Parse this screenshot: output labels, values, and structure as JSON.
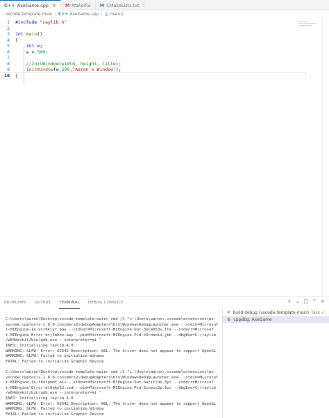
{
  "tabs": [
    {
      "icon": "C++",
      "label": "AxeGame.cpp",
      "active": true,
      "close": "×"
    },
    {
      "icon": "M",
      "label": "Makefile",
      "active": false,
      "italic": true
    },
    {
      "icon": "M",
      "label": "CMakeLists.txt",
      "active": false
    }
  ],
  "breadcrumb": {
    "folder": "vscode-template-main",
    "sep": "›",
    "file_icon": "C++",
    "file": "AxeGame.cpp",
    "symbol": "main()"
  },
  "code_lines": [
    {
      "n": "1",
      "tokens": [
        {
          "t": "#include ",
          "c": "tk-pre"
        },
        {
          "t": "\"raylib.h\"",
          "c": "tk-str"
        }
      ]
    },
    {
      "n": "2",
      "tokens": []
    },
    {
      "n": "3",
      "tokens": [
        {
          "t": "int",
          "c": "tk-kw"
        },
        {
          "t": " ",
          "c": ""
        },
        {
          "t": "main",
          "c": "tk-fn"
        },
        {
          "t": "()",
          "c": ""
        }
      ]
    },
    {
      "n": "4",
      "tokens": [
        {
          "t": "{",
          "c": ""
        }
      ]
    },
    {
      "n": "5",
      "tokens": [
        {
          "t": "    ",
          "c": ""
        },
        {
          "t": "int",
          "c": "tk-kw"
        },
        {
          "t": " ",
          "c": ""
        },
        {
          "t": "w",
          "c": "tk-var"
        },
        {
          "t": ";",
          "c": ""
        }
      ]
    },
    {
      "n": "6",
      "tokens": [
        {
          "t": "    ",
          "c": ""
        },
        {
          "t": "w",
          "c": "tk-var"
        },
        {
          "t": " = ",
          "c": ""
        },
        {
          "t": "500",
          "c": "tk-num"
        },
        {
          "t": ";",
          "c": ""
        }
      ]
    },
    {
      "n": "7",
      "tokens": []
    },
    {
      "n": "8",
      "tokens": [
        {
          "t": "    ",
          "c": ""
        },
        {
          "t": "//InitWindow(width, height, title);",
          "c": "tk-cm"
        }
      ]
    },
    {
      "n": "9",
      "tokens": [
        {
          "t": "    ",
          "c": ""
        },
        {
          "t": "InitWindow",
          "c": "tk-fn"
        },
        {
          "t": "(",
          "c": ""
        },
        {
          "t": "w",
          "c": "tk-var"
        },
        {
          "t": ",",
          "c": ""
        },
        {
          "t": "500",
          "c": "tk-num"
        },
        {
          "t": ",",
          "c": ""
        },
        {
          "t": "\"Aaron's Window\"",
          "c": "tk-str"
        },
        {
          "t": ");",
          "c": ""
        }
      ]
    },
    {
      "n": "10",
      "tokens": [
        {
          "t": "}",
          "c": ""
        }
      ],
      "current": true
    }
  ],
  "panel": {
    "tabs": [
      "PROBLEMS",
      "OUTPUT",
      "TERMINAL",
      "DEBUG CONSOLE"
    ],
    "active_tab": 2,
    "actions": [
      "+",
      "⌄",
      "□",
      "⌃",
      "×"
    ]
  },
  "terminal_lines": [
    "C:\\Users\\aaron\\Desktop\\vscode-template-main> cmd /C \"c:\\Users\\aaron\\.vscode\\extensions\\ms-",
    "vscode.cpptools-1.8.0-insiders2\\debugAdapters\\bin\\WindowsDebugLauncher.exe --stdin=Microsof",
    "t-MIEngine-In-ycr0klyr.bay --stdout=Microsoft-MIEngine-Out-3nlm053u.lte --stderr=Microsof",
    "t-MIEngine-Error-brj3mhhx.awy --pid=Microsoft-MIEngine-Pid-x5roboid.jbb --dbgExe=C:/raylib",
    "/w64devkit/bin/gdb.exe --interpreter=mi \"",
    "INFO: Initializing raylib 4.0",
    "WARNING: GLFW: Error: 65542 Description: WGL: The driver does not appear to support OpenGL",
    "WARNING: GLFW: Failed to initialize Window",
    "FATAL: Failed to initialize Graphic Device",
    "",
    "C:\\Users\\aaron\\Desktop\\vscode-template-main> cmd /C \"c:\\Users\\aaron\\.vscode\\extensions\\ms-",
    "vscode.cpptools-1.8.0-insiders2\\debugAdapters\\bin\\WindowsDebugLauncher.exe --stdin=Microsof",
    "t-MIEngine-In-fhxspkmf.bii --stdout=Microsoft-MIEngine-Out-hafitldo.3yr --stderr=Microsof",
    "t-MIEngine-Error-dl0qkn52.vzd --pid=Microsoft-MIEngine-Pid-5inecc2p.1oc --dbgExe=C:/raylib",
    "/w64devkit/bin/gdb.exe --interpreter=mi \"",
    "INFO: Initializing raylib 4.0",
    "WARNING: GLFW: Error: 65542 Description: WGL: The driver does not appear to support OpenGL",
    "WARNING: GLFW: Failed to initialize Window",
    "FATAL: Failed to initialize Graphic Device"
  ],
  "terminal_list": [
    {
      "icon": "⚲",
      "label": "build debug (vscode-template-main)",
      "sub": "Task",
      "check": "✓",
      "selected": false
    },
    {
      "icon": "⚙",
      "label": "cppdbg: AxeGame",
      "sub": "",
      "check": "",
      "selected": true
    }
  ],
  "colors": {
    "accent": "#0066b8",
    "keyword": "#0000ff",
    "string": "#a31515",
    "comment": "#008000",
    "number": "#098658",
    "function": "#795e26",
    "variable": "#001080",
    "line_number": "#237893"
  }
}
